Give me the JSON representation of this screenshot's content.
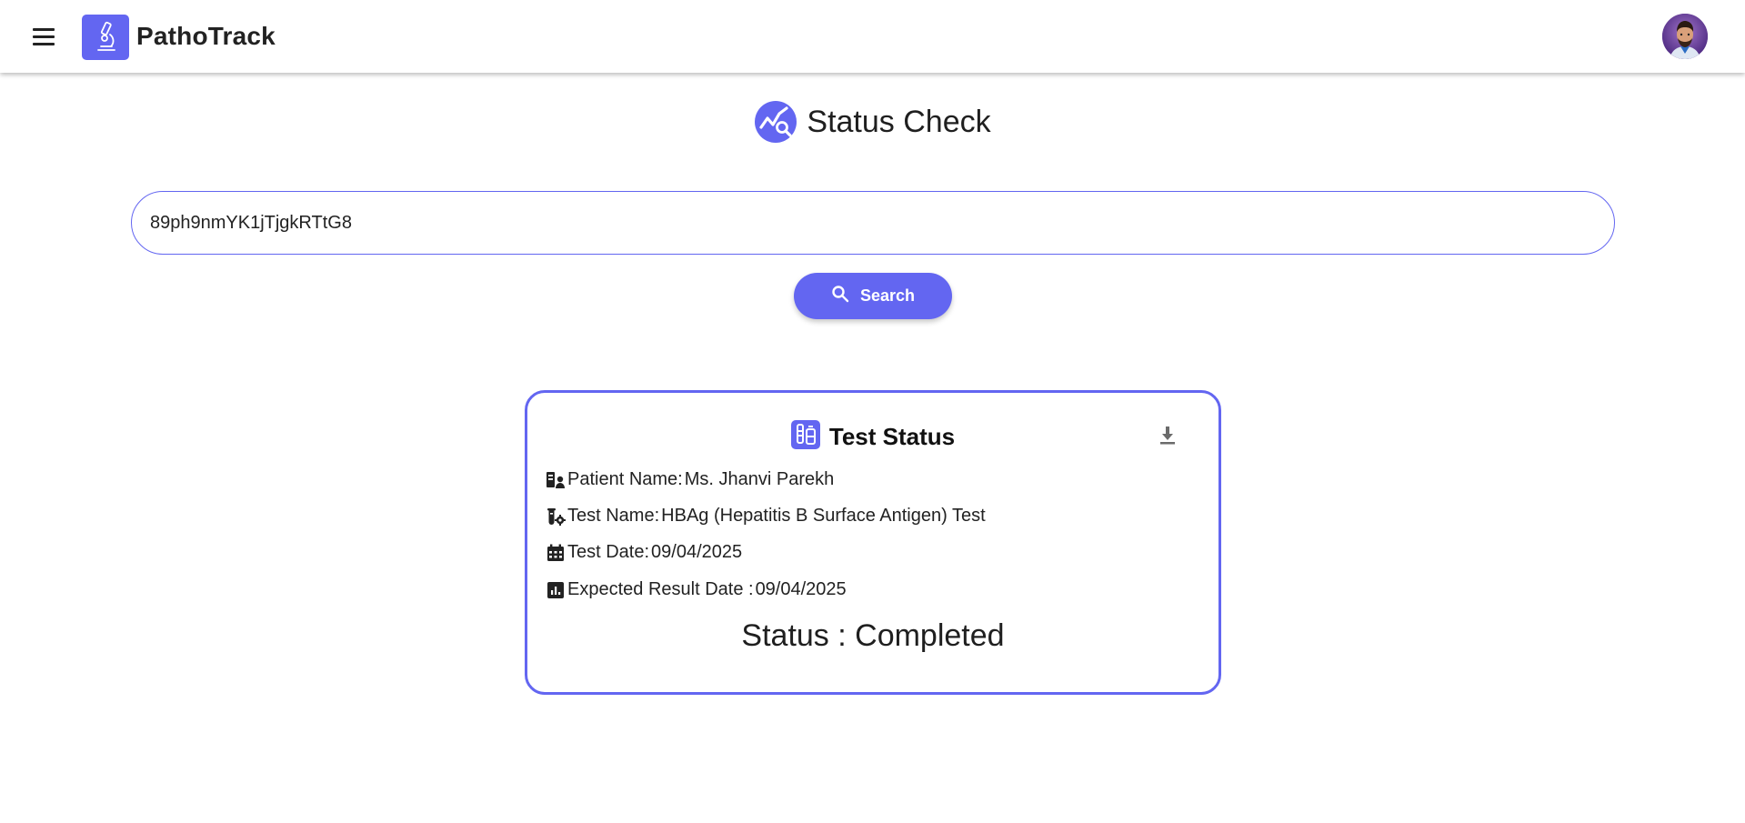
{
  "header": {
    "brand": "PathoTrack",
    "icons": {
      "menu": "menu-icon",
      "logo": "microscope-icon",
      "avatar": "avatar"
    }
  },
  "page": {
    "title": "Status Check",
    "title_icon": "analytics-search-icon"
  },
  "search": {
    "value": "89ph9nmYK1jTjgkRTtG8",
    "button_label": "Search",
    "button_icon": "search-icon"
  },
  "card": {
    "title": "Test Status",
    "title_icon": "test-tube-icon",
    "download_icon": "download-icon",
    "fields": [
      {
        "icon": "patient-icon",
        "label": "Patient Name: ",
        "value": "Ms. Jhanvi Parekh"
      },
      {
        "icon": "test-settings-icon",
        "label": "Test Name: ",
        "value": "HBAg (Hepatitis B Surface Antigen) Test"
      },
      {
        "icon": "calendar-icon",
        "label": "Test Date:",
        "value": "09/04/2025"
      },
      {
        "icon": "chart-icon",
        "label": "Expected Result Date :",
        "value": "09/04/2025"
      }
    ],
    "status_text": "Status : Completed"
  },
  "colors": {
    "accent": "#6366f1",
    "text": "#1f1f1f"
  }
}
